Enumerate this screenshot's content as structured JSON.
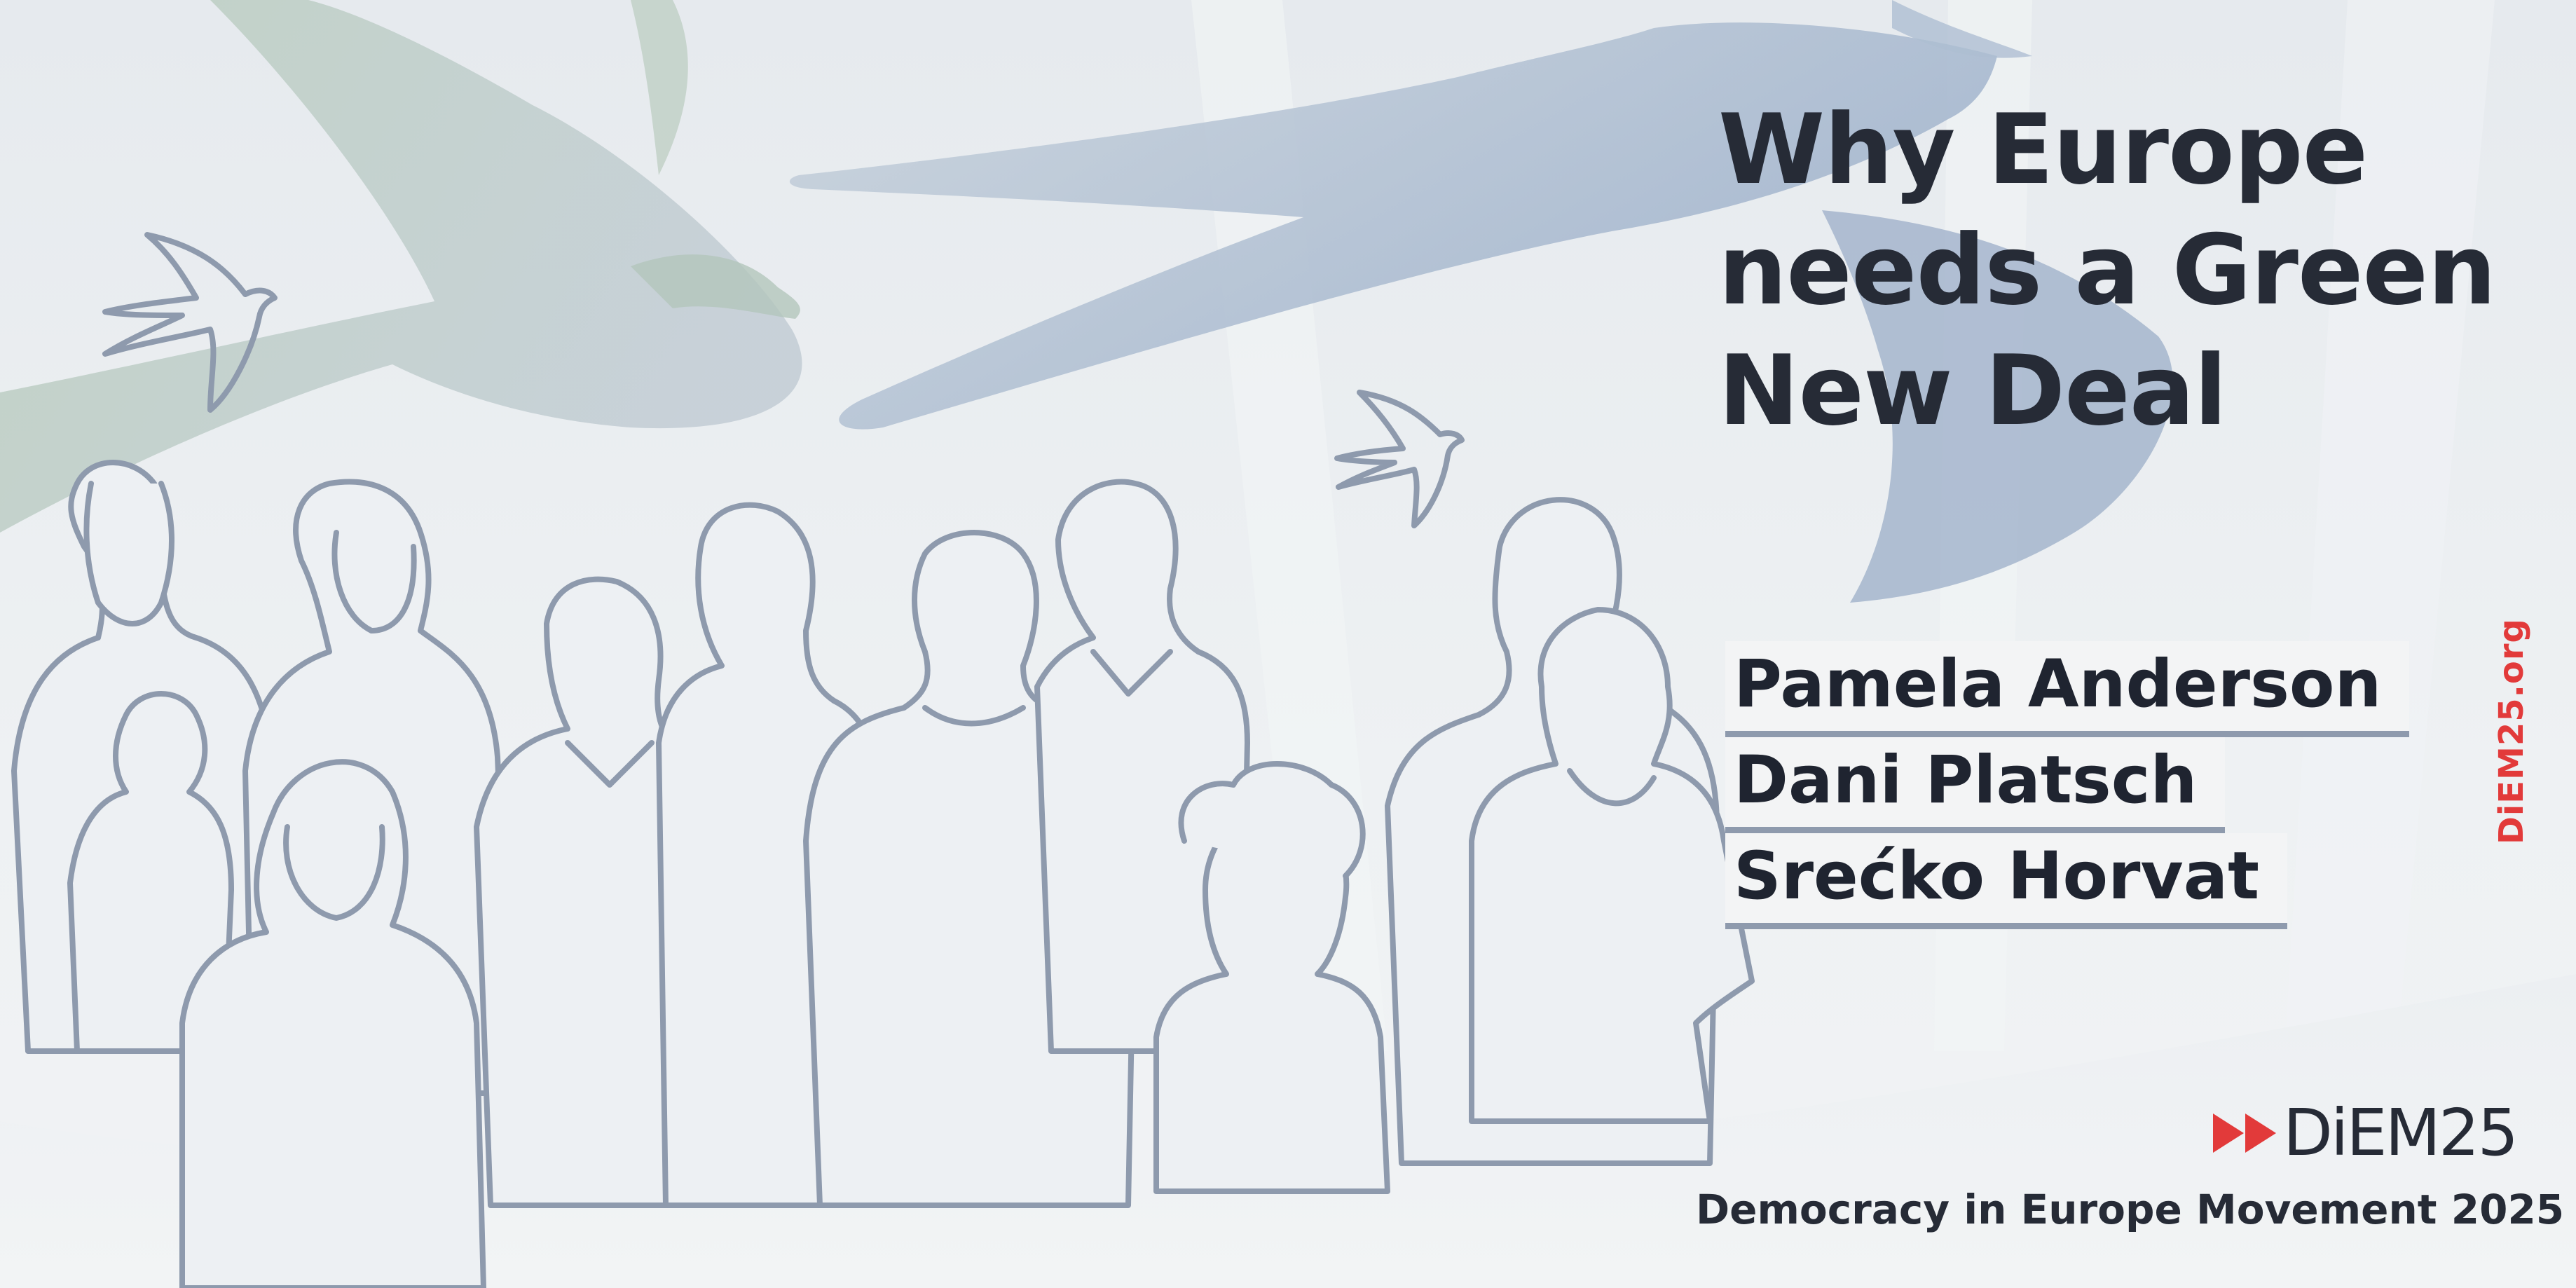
{
  "poster": {
    "title": "Why Europe needs a Green New Deal",
    "speakers": [
      {
        "name": "Pamela Anderson"
      },
      {
        "name": "Dani Platsch"
      },
      {
        "name": "Srećko Horvat"
      }
    ],
    "website": "DiEM25.org",
    "logo": {
      "text": "DiEM25",
      "icon": "double-play-arrows-icon"
    },
    "tagline": "Democracy in Europe Movement 2025",
    "colors": {
      "background": "#eef1f3",
      "title": "#262b36",
      "accent_red": "#e23a3a",
      "line_art": "#8e9aad",
      "swallow_green": "#b9ccbc",
      "swallow_blue": "#a9b8cf"
    }
  }
}
